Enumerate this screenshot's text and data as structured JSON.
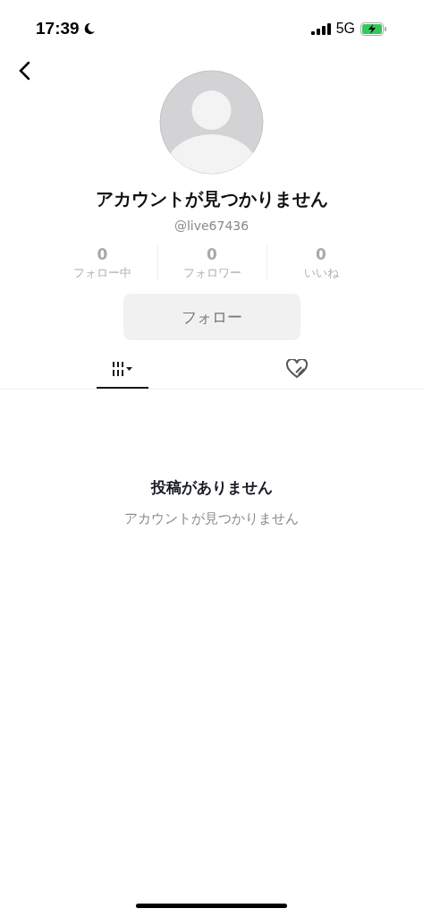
{
  "status_bar": {
    "time": "17:39",
    "network": "5G"
  },
  "profile": {
    "name": "アカウントが見つかりません",
    "handle": "@live67436"
  },
  "stats": [
    {
      "value": "0",
      "label": "フォロー中"
    },
    {
      "value": "0",
      "label": "フォロワー"
    },
    {
      "value": "0",
      "label": "いいね"
    }
  ],
  "follow_button": {
    "label": "フォロー",
    "disabled": true
  },
  "tabs": [
    {
      "kind": "grid",
      "selected": true
    },
    {
      "kind": "liked",
      "selected": false
    }
  ],
  "empty_state": {
    "title": "投稿がありません",
    "message": "アカウントが見つかりません"
  }
}
